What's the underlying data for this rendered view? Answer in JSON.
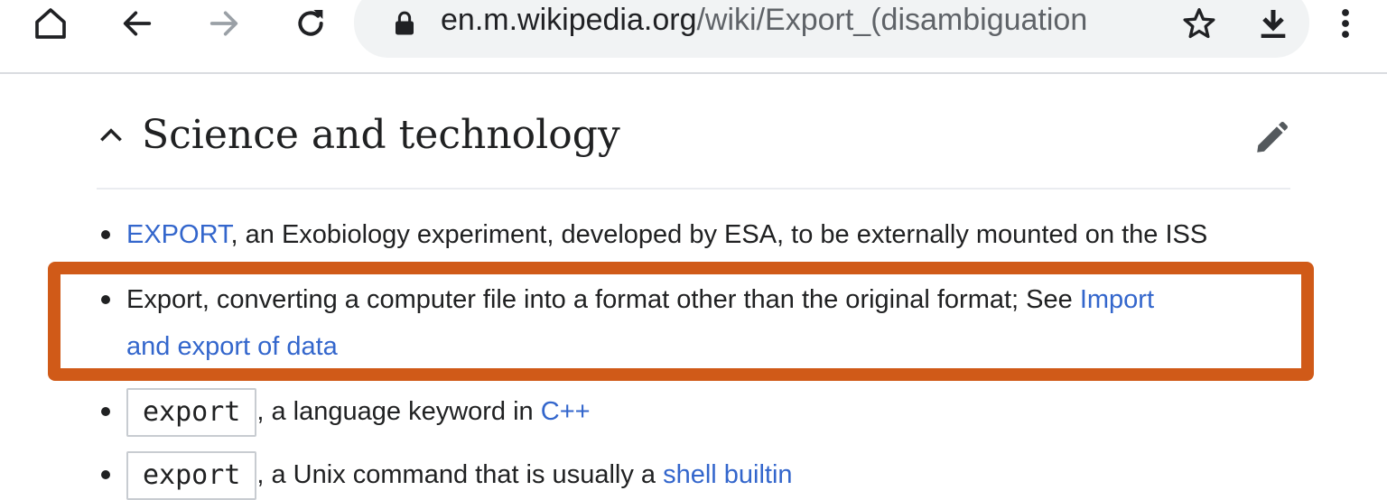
{
  "browser": {
    "url_host": "en.m.wikipedia.org",
    "url_path": "/wiki/Export_(disambiguation",
    "icons": [
      "home-icon",
      "back-icon",
      "forward-icon",
      "reload-icon",
      "lock-icon",
      "star-icon",
      "download-icon",
      "more-vert-icon"
    ]
  },
  "section": {
    "title": "Science and technology"
  },
  "items": [
    {
      "link": "EXPORT",
      "text": ", an Exobiology experiment, developed by ESA, to be externally mounted on the ISS"
    },
    {
      "text": "Export, converting a computer file into a format other than the original format; See ",
      "link_line1": "Import",
      "link_line2": "and export of data"
    },
    {
      "code": "export",
      "text": ", a language keyword in ",
      "link": "C++"
    },
    {
      "code": "export",
      "text": ", a Unix command that is usually a ",
      "link": "shell builtin"
    }
  ],
  "colors": {
    "link": "#3366cc",
    "highlight_border": "#d05a18",
    "url_bar_bg": "#f1f3f4"
  }
}
